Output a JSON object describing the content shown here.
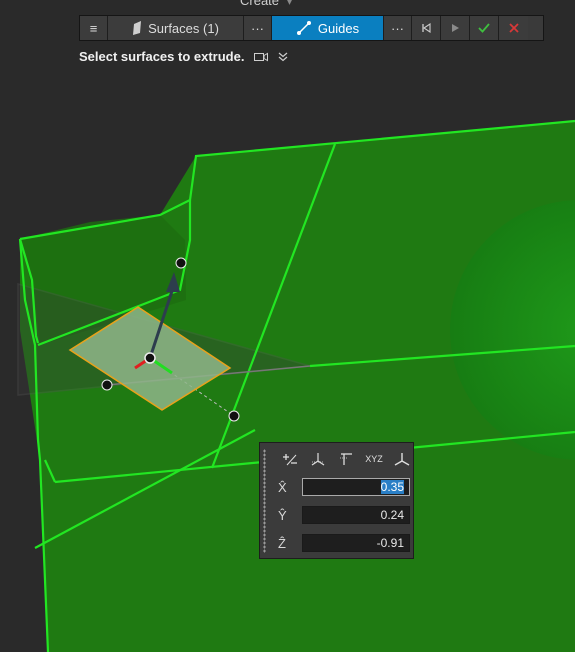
{
  "top_menu": {
    "label": "Create",
    "caret": "▾"
  },
  "toolbar": {
    "menu_icon": "≡",
    "surfaces_label": "Surfaces (1)",
    "more_label": "···",
    "guides_label": "Guides",
    "more2_label": "···",
    "colors": {
      "active": "#0a7fc0",
      "accept": "#3fbf3f",
      "cancel": "#d83838"
    }
  },
  "prompt": {
    "text": "Select surfaces to extrude.",
    "camera_icon": "camera-icon",
    "expand_icon": "double-chevron-down-icon"
  },
  "coord_panel": {
    "tools": [
      "+/-",
      "axes-icon",
      "plane-icon",
      "XYZ",
      "frame-icon"
    ],
    "xyz_label": "XYZ",
    "rows": [
      {
        "axis": "X̂",
        "value": "0.35"
      },
      {
        "axis": "Ŷ",
        "value": "0.24"
      },
      {
        "axis": "Ẑ",
        "value": "-0.91"
      }
    ]
  },
  "scene": {
    "surface_color": "#1f7d12",
    "edge_color": "#22ee22",
    "sphere_color": "#1c8f18",
    "plane_fill": "#8fb58a",
    "plane_edge": "#e8a21a"
  }
}
